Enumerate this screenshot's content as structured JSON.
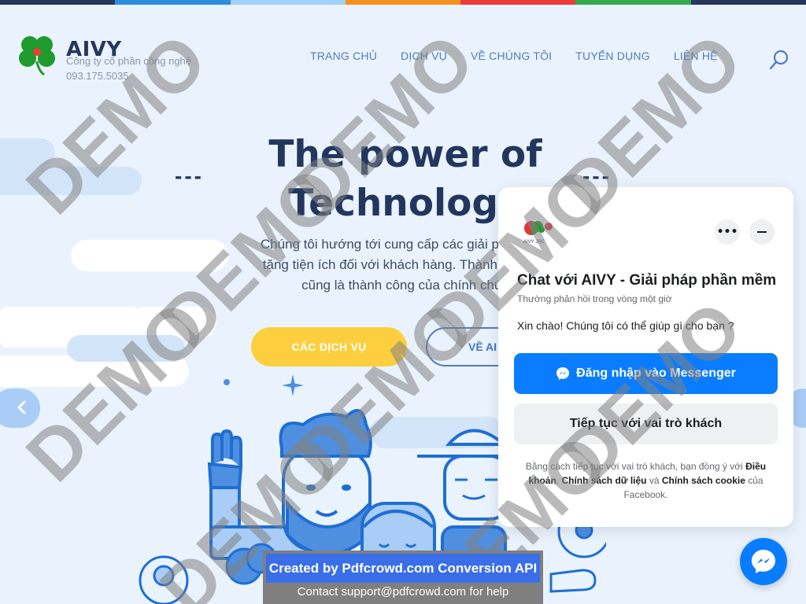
{
  "colors": {
    "strip": [
      "#26365c",
      "#2f8de0",
      "#9fd2fa",
      "#f3921f",
      "#ec3a3d",
      "#35a84a",
      "#26365c"
    ],
    "accent_yellow": "#fdcf3f",
    "accent_blue": "#4f79c1",
    "messenger_blue": "#0a7cff"
  },
  "header": {
    "brand": "AIVY",
    "tagline": "Công ty cổ phần công nghệ",
    "phone": "093.175.5035",
    "nav": [
      "TRANG CHỦ",
      "DỊCH VỤ",
      "VỀ CHÚNG TÔI",
      "TUYỂN DỤNG",
      "LIÊN HỆ"
    ],
    "search_icon": "search-icon"
  },
  "hero": {
    "title_line1": "The power of",
    "title_line2": "Technology",
    "dashes_left": "---",
    "dashes_right": "---",
    "desc_line1": "Chúng tôi hướng tới cung cấp các giải pháp hiện",
    "desc_line2": "tăng tiện ích đối với khách hàng. Thành công củ",
    "desc_line3": "cũng là thành công của chính chún",
    "btn_services": "CÁC DỊCH VỤ",
    "btn_about": "VỀ AI"
  },
  "chat": {
    "logo_text": "AIVY JSC",
    "title": "Chat với AIVY - Giải pháp phần mềm",
    "subtitle": "Thường phản hồi trong vòng một giờ",
    "message": "Xin chào! Chúng tôi có thể giúp gì cho bạn ?",
    "login_button": "Đăng nhập vào Messenger",
    "guest_button": "Tiếp tục với vai trò khách",
    "legal_prefix": "Bằng cách tiếp tục với vai trò khách, bạn đồng ý với ",
    "legal_terms": "Điều khoản",
    "legal_sep1": ", ",
    "legal_data": "Chính sách dữ liệu",
    "legal_and": " và ",
    "legal_cookie": "Chính sách cookie",
    "legal_suffix": " của Facebook.",
    "more_label": "•••"
  },
  "watermark": "DEMO",
  "banner": {
    "title": "Created by Pdfcrowd.com Conversion API",
    "contact_prefix": "Contact ",
    "contact_email": "support@pdfcrowd.com",
    "contact_suffix": " for help"
  }
}
